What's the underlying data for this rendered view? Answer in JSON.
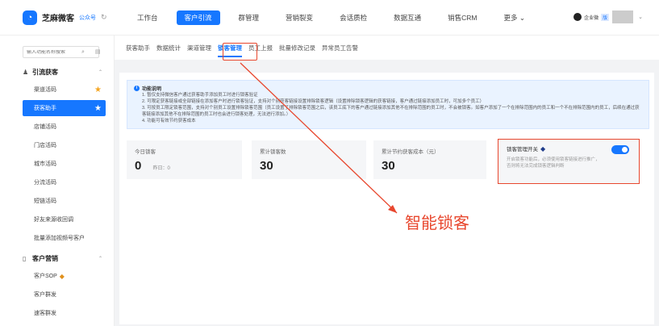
{
  "topbar": {
    "logo_text": "芝麻微客",
    "logo_sub": "公众号",
    "nav": [
      {
        "label": "工作台"
      },
      {
        "label": "客户引流",
        "active": true
      },
      {
        "label": "群管理"
      },
      {
        "label": "营销裂变"
      },
      {
        "label": "会话质检"
      },
      {
        "label": "数据互通"
      },
      {
        "label": "销售CRM"
      },
      {
        "label": "更多 ⌄"
      }
    ],
    "user_text": "企业微",
    "user_tag": "版"
  },
  "sidebar": {
    "search_placeholder": "输入功能名称搜索",
    "group1": {
      "label": "引流获客"
    },
    "items1": [
      {
        "label": "渠道活码",
        "star": true
      },
      {
        "label": "获客助手",
        "active": true,
        "star": true
      },
      {
        "label": "店铺活码"
      },
      {
        "label": "门店活码"
      },
      {
        "label": "城市活码"
      },
      {
        "label": "分流活码"
      },
      {
        "label": "短链活码"
      },
      {
        "label": "好友来源收回调"
      },
      {
        "label": "批量添加视频号客户"
      }
    ],
    "group2": {
      "label": "客户营销"
    },
    "items2": [
      {
        "label": "客户SOP",
        "diamond": true
      },
      {
        "label": "客户群发"
      },
      {
        "label": "速客群发"
      }
    ]
  },
  "subtabs": [
    {
      "label": "获客助手"
    },
    {
      "label": "数据统计"
    },
    {
      "label": "渠道管理"
    },
    {
      "label": "锁客管理",
      "active": true
    },
    {
      "label": "员工上报"
    },
    {
      "label": "批量修改记录"
    },
    {
      "label": "异常员工告警"
    }
  ],
  "notice": {
    "title": "功能说明",
    "lines": [
      "1. 暂仅支持微信客户通过获客助手添加员工时进行锁客验证",
      "2. 可限定获客链接或全部链接在添加客户时进行锁客验证，支持对个别获客链接设置排除锁客逻辑（设置排除锁客逻辑的获客链接，客户通过链接添加员工时，可加多个员工）",
      "3. 可按员工限定锁客范围，支持对个别员工设置排除锁客范围（员工设置了排除锁客范围之后，该员工底下的客户通过链接添加其他不在排除范围的员工时，不会被锁客。如客户添加了一个在排除范围内的员工和一个不在排除范围内的员工，后续在通过获客链接添加其他不在排除范围的员工时也会进行锁客处理，无法进行添加。）",
      "4. 功能可有效节约获客成本"
    ]
  },
  "stats": {
    "today": {
      "label": "今日锁客",
      "value": "0",
      "sub": "昨日：0"
    },
    "total": {
      "label": "累计锁客数",
      "value": "30"
    },
    "cost": {
      "label": "累计节约获客成本（元）",
      "value": "30"
    }
  },
  "lock_switch": {
    "label": "锁客管理开关",
    "enabled": true,
    "desc_line1": "开启锁客功能后，必须使用锁客链接进行推广，",
    "desc_line2": "否则将无法完成锁客逻辑判断"
  },
  "annotation": {
    "text": "智能锁客",
    "color": "#e8472e"
  }
}
